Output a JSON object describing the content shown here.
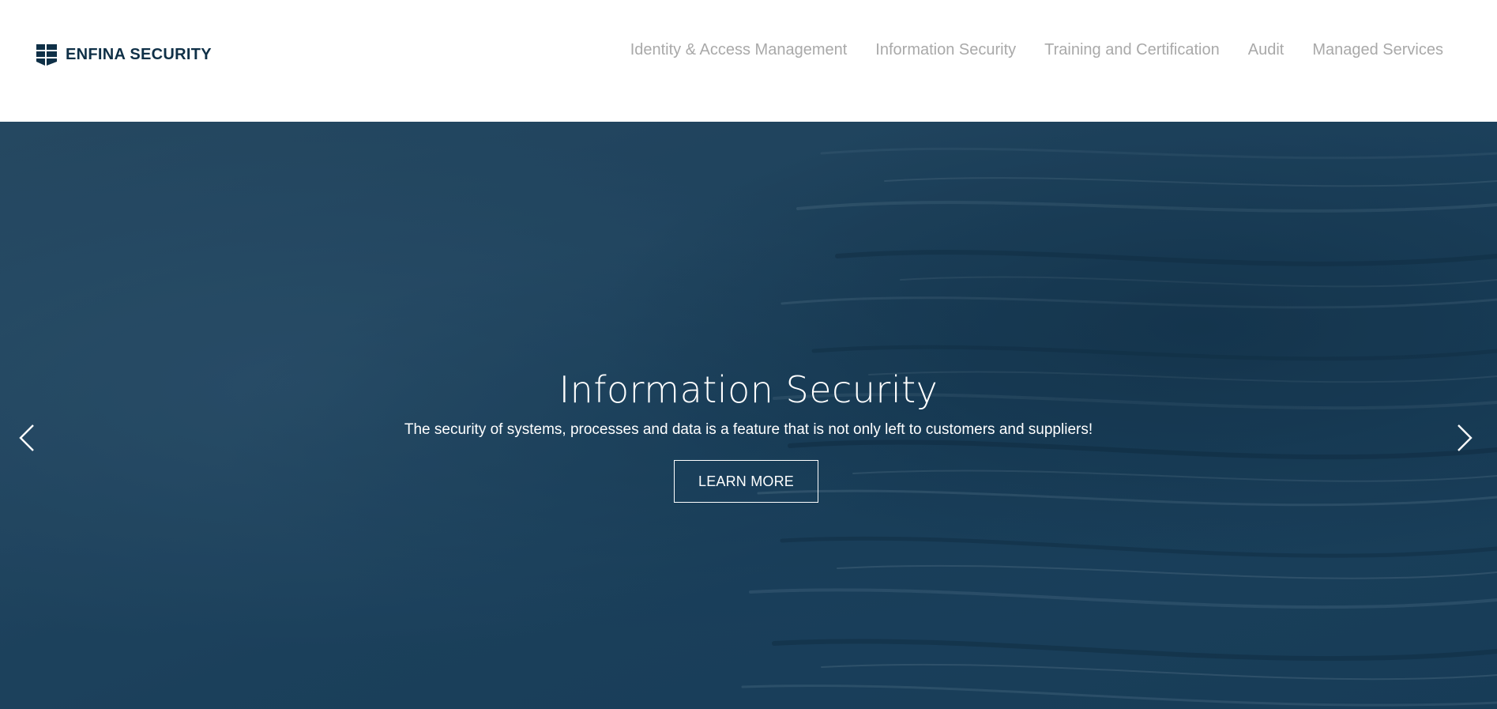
{
  "brand": {
    "name": "ENFINA SECURITY",
    "color": "#0f3047"
  },
  "nav": {
    "items": [
      {
        "label": "Identity & Access Management"
      },
      {
        "label": "Information Security"
      },
      {
        "label": "Training and Certification"
      },
      {
        "label": "Audit"
      },
      {
        "label": "Managed Services"
      }
    ],
    "color": "#a9a9a9"
  },
  "hero": {
    "title": "Information Security",
    "subtitle": "The security of systems, processes and data is a feature that is not only left to customers and suppliers!",
    "cta_label": "LEARN MORE",
    "overlay_color": "#1f4560",
    "background_image": "stacked-paper-documents",
    "prev_icon": "chevron-left-icon",
    "next_icon": "chevron-right-icon"
  }
}
